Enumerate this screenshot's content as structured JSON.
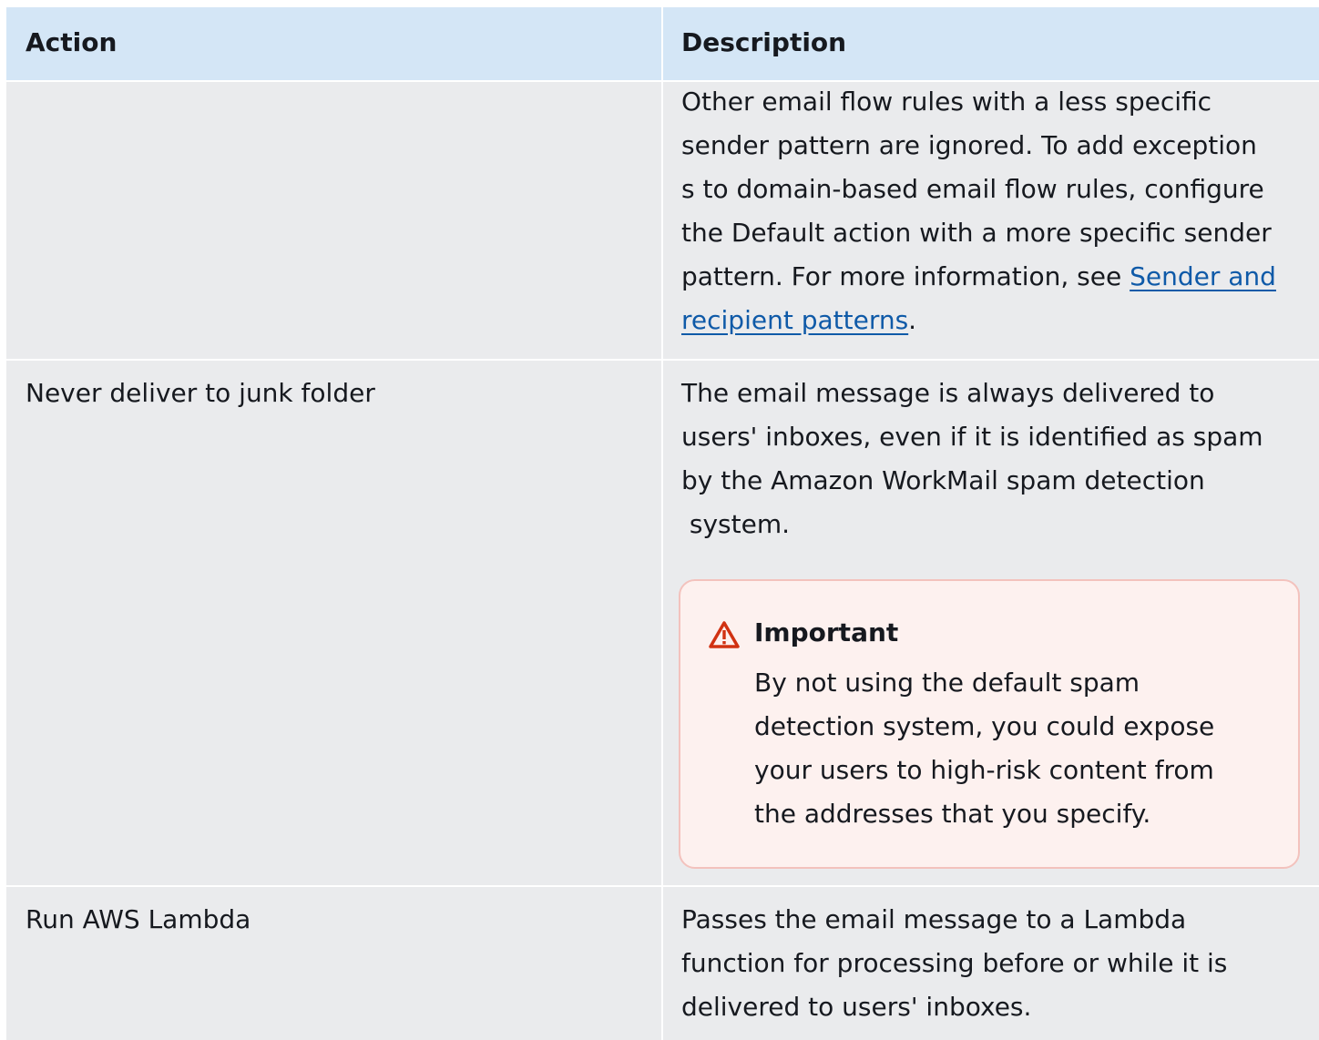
{
  "header": {
    "action": "Action",
    "description": "Description"
  },
  "rows": [
    {
      "action": "",
      "description_lines": [
        "Other email flow rules with a less specific",
        "sender pattern are ignored. To add exception",
        "s to domain-based email flow rules, configure",
        "the Default action with a more specific sender",
        "pattern. For more information, see "
      ],
      "link_part1": "Sender and",
      "link_part2": "recipient patterns",
      "trailing": "."
    },
    {
      "action": "Never deliver to junk folder",
      "description_lines": [
        "The email message is always delivered to",
        "users' inboxes, even if it is identified as spam",
        "by the Amazon WorkMail spam detection",
        " system."
      ],
      "callout": {
        "icon": "warning-icon",
        "title": "Important",
        "body_lines": [
          "By not using the default spam",
          "detection system, you could expose",
          "your users to high-risk content from",
          "the addresses that you specify."
        ]
      }
    },
    {
      "action": "Run AWS Lambda",
      "description_lines": [
        "Passes the email message to a Lambda",
        "function for processing before or while it is",
        "delivered to users' inboxes."
      ]
    }
  ],
  "colors": {
    "header_bg": "#d4e6f6",
    "row_bg": "#eaebed",
    "link": "#0f5aa8",
    "callout_bg": "#fdf1ef",
    "callout_border": "#f3c2bd",
    "warning": "#d13212"
  }
}
